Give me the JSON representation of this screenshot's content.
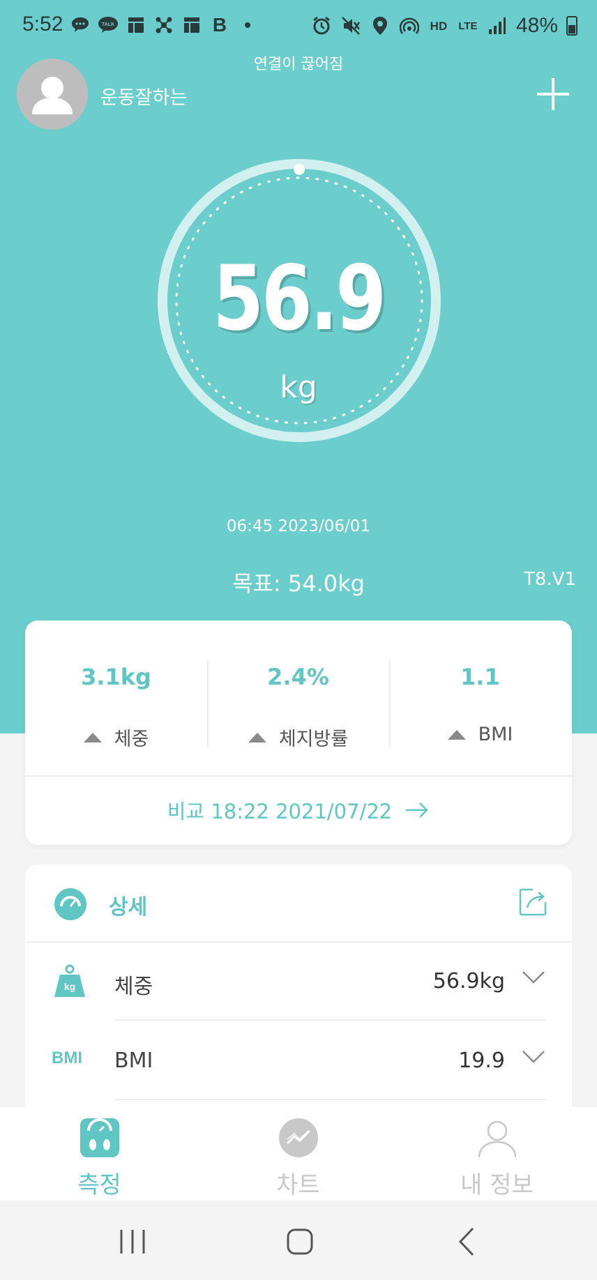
{
  "status_bar": {
    "time": "5:52",
    "left_icons": [
      "chat-icon",
      "kakaotalk-icon",
      "news-icon",
      "network-icon",
      "news-icon",
      "b-app-icon",
      "dot-icon"
    ],
    "kakaotalk_label": "TALK",
    "b_label": "B",
    "right_icons": [
      "alarm-icon",
      "mute-icon",
      "location-icon",
      "hotspot-icon",
      "hd-voice-icon",
      "lte-icon",
      "signal-icon"
    ],
    "hd_label": "HD",
    "lte_label": "LTE",
    "battery": "48%"
  },
  "header": {
    "connection_status": "연결이 끊어짐",
    "username": "운동잘하는"
  },
  "measurement": {
    "weight": "56.9",
    "unit": "kg",
    "timestamp": "06:45 2023/06/01",
    "goal": "목표: 54.0kg",
    "version": "T8.V1"
  },
  "summary": {
    "stats": [
      {
        "value": "3.1kg",
        "label": "체중"
      },
      {
        "value": "2.4%",
        "label": "체지방률"
      },
      {
        "value": "1.1",
        "label": "BMI"
      }
    ],
    "compare": "비교 18:22 2021/07/22"
  },
  "detail": {
    "title": "상세",
    "rows": [
      {
        "icon": "kg-weight-icon",
        "icon_text": "kg",
        "label": "체중",
        "value": "56.9kg"
      },
      {
        "icon": "bmi-icon",
        "icon_text": "BMI",
        "label": "BMI",
        "value": "19.9"
      }
    ]
  },
  "tabs": [
    {
      "label": "측정",
      "icon": "scale-icon",
      "active": true
    },
    {
      "label": "차트",
      "icon": "chart-icon",
      "active": false
    },
    {
      "label": "내 정보",
      "icon": "profile-icon",
      "active": false
    }
  ],
  "colors": {
    "teal": "#6ccdcd",
    "accent": "#5fc6c4",
    "inactive": "#c8c8c8"
  }
}
